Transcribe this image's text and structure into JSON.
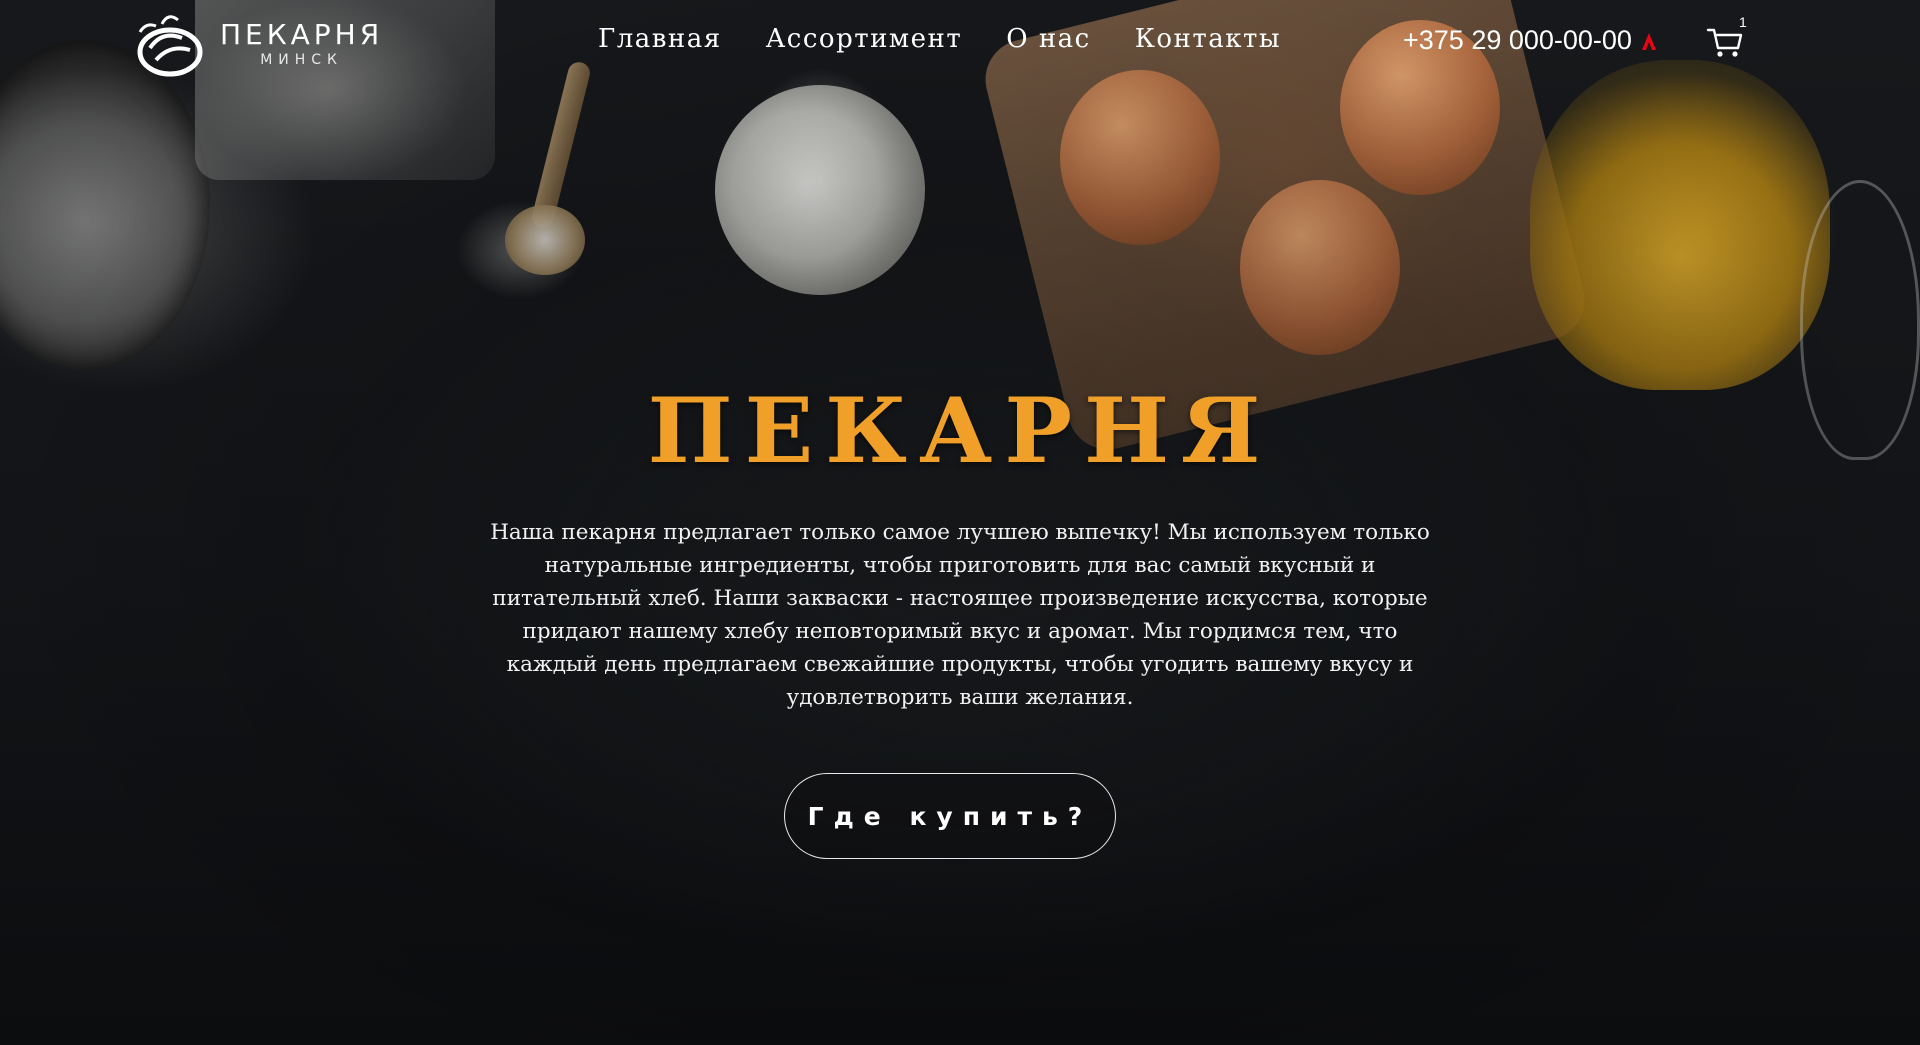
{
  "brand": {
    "name": "ПЕКАРНЯ",
    "city": "МИНСК",
    "accent_color": "#f0a029"
  },
  "nav": {
    "items": [
      {
        "label": "Главная"
      },
      {
        "label": "Ассортимент"
      },
      {
        "label": "О нас"
      },
      {
        "label": "Контакты"
      }
    ]
  },
  "header": {
    "phone": "+375 29 000-00-00",
    "phone_icon": "a1-operator-icon",
    "cart_icon": "shopping-cart-icon",
    "cart_count": "1"
  },
  "hero": {
    "title": "ПЕКАРНЯ",
    "text": "Наша пекарня предлагает только самое лучшею выпечку! Мы используем только натуральные ингредиенты, чтобы приготовить для вас самый вкусный и питательный хлеб. Наши закваски - настоящее произведение искусства, которые придают нашему хлебу неповторимый вкус и аромат. Мы гордимся тем, что каждый день предлагаем свежайшие продукты, чтобы угодить вашему вкусу и удовлетворить ваши желания.",
    "cta_label": "Где купить?"
  }
}
